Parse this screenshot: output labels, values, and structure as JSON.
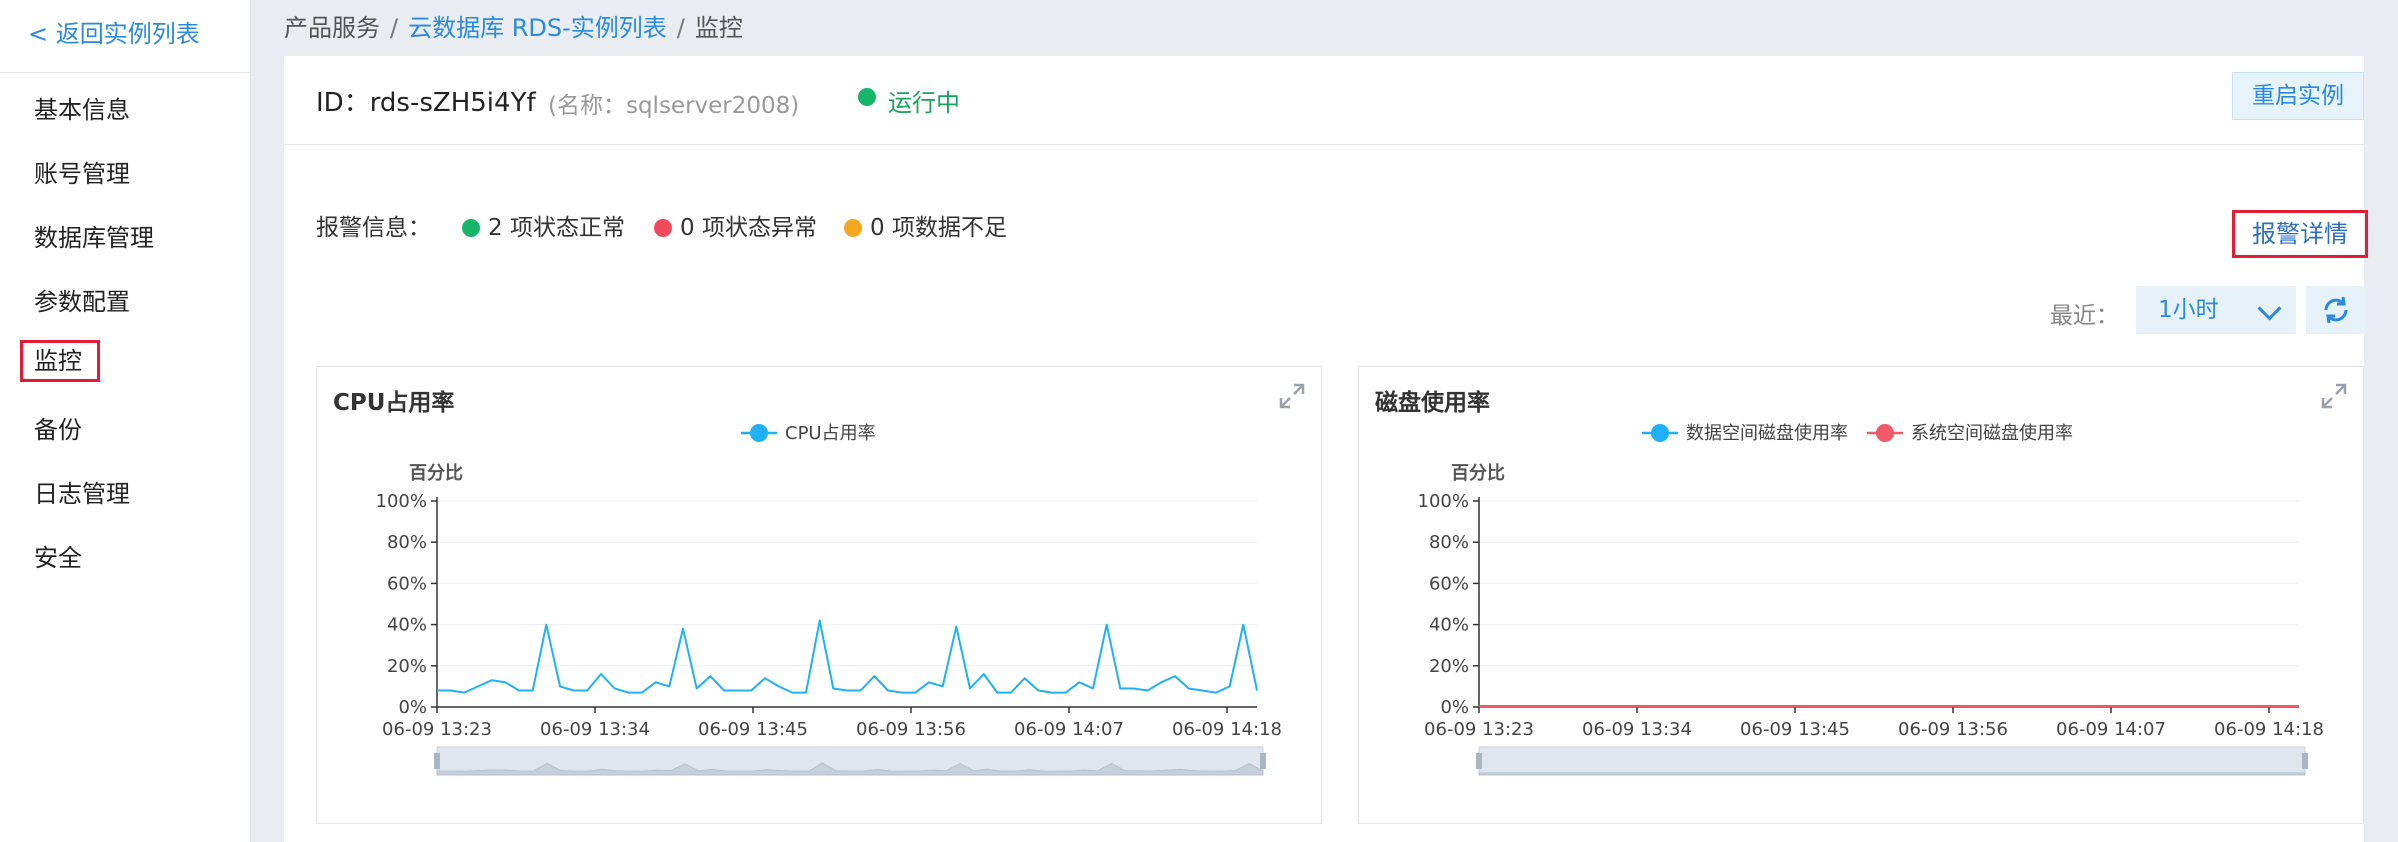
{
  "sidebar": {
    "back_label": "< 返回实例列表",
    "items": [
      {
        "label": "基本信息",
        "name": "sidebar-item-basic-info"
      },
      {
        "label": "账号管理",
        "name": "sidebar-item-account"
      },
      {
        "label": "数据库管理",
        "name": "sidebar-item-database"
      },
      {
        "label": "参数配置",
        "name": "sidebar-item-params"
      },
      {
        "label": "监控",
        "name": "sidebar-item-monitor"
      },
      {
        "label": "备份",
        "name": "sidebar-item-backup"
      },
      {
        "label": "日志管理",
        "name": "sidebar-item-logs"
      },
      {
        "label": "安全",
        "name": "sidebar-item-security"
      }
    ]
  },
  "breadcrumb": {
    "items": [
      "产品服务",
      "云数据库 RDS-实例列表",
      "监控"
    ],
    "separator": "/"
  },
  "instance": {
    "id_text": "ID：rds-sZH5i4Yf",
    "name_text": "(名称：sqlserver2008)",
    "status": "运行中",
    "restart_label": "重启实例"
  },
  "alerts": {
    "label": "报警信息：",
    "normal": "2 项状态正常",
    "abnormal": "0 项状态异常",
    "insufficient": "0 项数据不足",
    "detail_label": "报警详情"
  },
  "range": {
    "label": "最近：",
    "value": "1小时"
  },
  "colors": {
    "accent": "#2a8adf",
    "ok": "#17b56a",
    "error": "#f04a5a",
    "warn": "#f5a623",
    "highlight_border": "#e21d35",
    "series_blue": "#1fb0f5",
    "series_red": "#f25a6a"
  },
  "chart_data": [
    {
      "type": "line",
      "title": "CPU占用率",
      "ylabel": "百分比",
      "y_ticks": [
        "0%",
        "20%",
        "40%",
        "60%",
        "80%",
        "100%"
      ],
      "ylim": [
        0,
        100
      ],
      "x_ticks": [
        "06-09 13:23",
        "06-09 13:34",
        "06-09 13:45",
        "06-09 13:56",
        "06-09 14:07",
        "06-09 14:18"
      ],
      "series": [
        {
          "name": "CPU占用率",
          "color": "#1fb0f5",
          "values": [
            8,
            8,
            7,
            10,
            13,
            12,
            8,
            8,
            40,
            10,
            8,
            8,
            16,
            9,
            7,
            7,
            12,
            10,
            38,
            9,
            15,
            8,
            8,
            8,
            14,
            10,
            7,
            7,
            42,
            9,
            8,
            8,
            15,
            8,
            7,
            7,
            12,
            10,
            39,
            9,
            16,
            7,
            7,
            14,
            8,
            7,
            7,
            12,
            9,
            40,
            9,
            9,
            8,
            12,
            15,
            9,
            8,
            7,
            10,
            40,
            8
          ]
        }
      ]
    },
    {
      "type": "line",
      "title": "磁盘使用率",
      "ylabel": "百分比",
      "y_ticks": [
        "0%",
        "20%",
        "40%",
        "60%",
        "80%",
        "100%"
      ],
      "ylim": [
        0,
        100
      ],
      "x_ticks": [
        "06-09 13:23",
        "06-09 13:34",
        "06-09 13:45",
        "06-09 13:56",
        "06-09 14:07",
        "06-09 14:18"
      ],
      "series": [
        {
          "name": "数据空间磁盘使用率",
          "color": "#1fb0f5",
          "values": [
            0.5,
            0.5,
            0.5,
            0.5,
            0.5,
            0.5,
            0.5,
            0.5,
            0.5,
            0.5,
            0.5
          ]
        },
        {
          "name": "系统空间磁盘使用率",
          "color": "#f25a6a",
          "values": [
            0.3,
            0.3,
            0.3,
            0.3,
            0.3,
            0.3,
            0.3,
            0.3,
            0.3,
            0.3,
            0.3
          ]
        }
      ]
    }
  ]
}
